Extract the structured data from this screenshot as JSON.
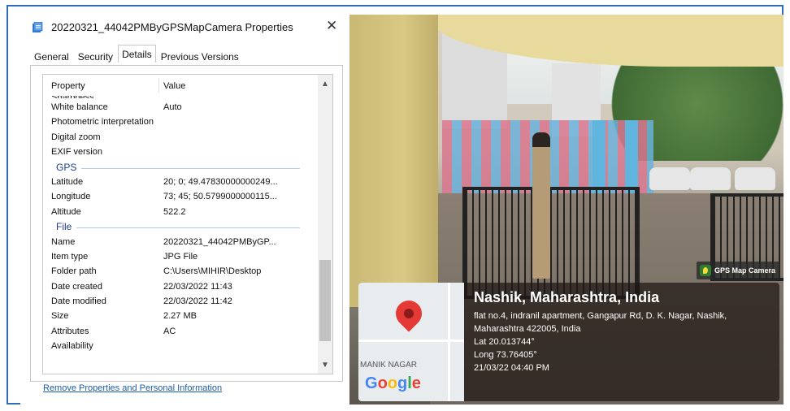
{
  "dialog": {
    "title": "20220321_44042PMByGPSMapCamera Properties",
    "close_glyph": "✕",
    "tabs": [
      "General",
      "Security",
      "Details",
      "Previous Versions"
    ],
    "active_tab": "Details",
    "columns": {
      "property": "Property",
      "value": "Value"
    },
    "clipped_row": "Sharpness",
    "rows": [
      {
        "type": "item",
        "property": "White balance",
        "value": "Auto"
      },
      {
        "type": "item",
        "property": "Photometric interpretation",
        "value": ""
      },
      {
        "type": "item",
        "property": "Digital zoom",
        "value": ""
      },
      {
        "type": "item",
        "property": "EXIF version",
        "value": ""
      },
      {
        "type": "group",
        "label": "GPS"
      },
      {
        "type": "item",
        "property": "Latitude",
        "value": "20; 0; 49.47830000000249..."
      },
      {
        "type": "item",
        "property": "Longitude",
        "value": "73; 45; 50.5799000000115..."
      },
      {
        "type": "item",
        "property": "Altitude",
        "value": "522.2"
      },
      {
        "type": "group",
        "label": "File"
      },
      {
        "type": "item",
        "property": "Name",
        "value": "20220321_44042PMByGP..."
      },
      {
        "type": "item",
        "property": "Item type",
        "value": "JPG File"
      },
      {
        "type": "item",
        "property": "Folder path",
        "value": "C:\\Users\\MIHIR\\Desktop"
      },
      {
        "type": "item",
        "property": "Date created",
        "value": "22/03/2022 11:43"
      },
      {
        "type": "item",
        "property": "Date modified",
        "value": "22/03/2022 11:42"
      },
      {
        "type": "item",
        "property": "Size",
        "value": "2.27 MB"
      },
      {
        "type": "item",
        "property": "Attributes",
        "value": "AC"
      },
      {
        "type": "item",
        "property": "Availability",
        "value": ""
      }
    ],
    "scroll_up_glyph": "▲",
    "scroll_down_glyph": "▼",
    "remove_link": "Remove Properties and Personal Information"
  },
  "photo": {
    "badge": "GPS Map Camera",
    "map_label": "MANIK NAGAR",
    "google_letters": [
      "G",
      "o",
      "o",
      "g",
      "l",
      "e"
    ],
    "city": "Nashik, Maharashtra, India",
    "address_line1": "flat no.4, indranil apartment, Gangapur Rd, D. K. Nagar, Nashik,",
    "address_line2": "Maharashtra 422005, India",
    "lat": "Lat 20.013744°",
    "long": "Long 73.76405°",
    "datetime": "21/03/22 04:40 PM"
  },
  "colors": {
    "accent_border": "#2f6db5",
    "group_header": "#1c3f8f",
    "link": "#1a5dab",
    "pin": "#e53935"
  },
  "icons": [
    "file-properties-icon",
    "close-icon",
    "chevron-up-icon",
    "chevron-down-icon",
    "map-pin-icon",
    "gps-map-camera-icon"
  ]
}
